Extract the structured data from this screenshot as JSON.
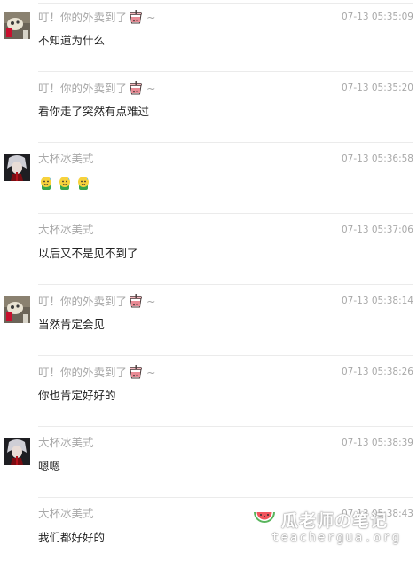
{
  "messages": [
    {
      "sender": "叮！你的外卖到了",
      "sender_suffix": "~",
      "show_cup": true,
      "avatar": "food-avatar",
      "time": "07-13 05:35:09",
      "text": "不知道为什么"
    },
    {
      "sender": "叮！你的外卖到了",
      "sender_suffix": "~",
      "show_cup": true,
      "avatar": "",
      "time": "07-13 05:35:20",
      "text": "看你走了突然有点难过"
    },
    {
      "sender": "大杯冰美式",
      "sender_suffix": "",
      "show_cup": false,
      "avatar": "character-avatar",
      "time": "07-13 05:36:58",
      "text": "",
      "emojis": [
        "sweating-emoji",
        "sweating-emoji",
        "sweating-emoji"
      ]
    },
    {
      "sender": "大杯冰美式",
      "sender_suffix": "",
      "show_cup": false,
      "avatar": "",
      "time": "07-13 05:37:06",
      "text": "以后又不是见不到了"
    },
    {
      "sender": "叮！你的外卖到了",
      "sender_suffix": "~",
      "show_cup": true,
      "avatar": "food-avatar",
      "time": "07-13 05:38:14",
      "text": "当然肯定会见"
    },
    {
      "sender": "叮！你的外卖到了",
      "sender_suffix": "~",
      "show_cup": true,
      "avatar": "",
      "time": "07-13 05:38:26",
      "text": "你也肯定好好的"
    },
    {
      "sender": "大杯冰美式",
      "sender_suffix": "",
      "show_cup": false,
      "avatar": "character-avatar",
      "time": "07-13 05:38:39",
      "text": "嗯嗯"
    },
    {
      "sender": "大杯冰美式",
      "sender_suffix": "",
      "show_cup": false,
      "avatar": "",
      "time": "07-13 05:38:43",
      "text": "我们都好好的"
    }
  ],
  "watermark": {
    "title": "瓜老师の笔记",
    "url": "teachergua.org"
  },
  "colors": {
    "meta_text": "#a8a8a8",
    "body_text": "#222222",
    "divider": "#ebebeb",
    "cup_pink": "#e98b95"
  }
}
